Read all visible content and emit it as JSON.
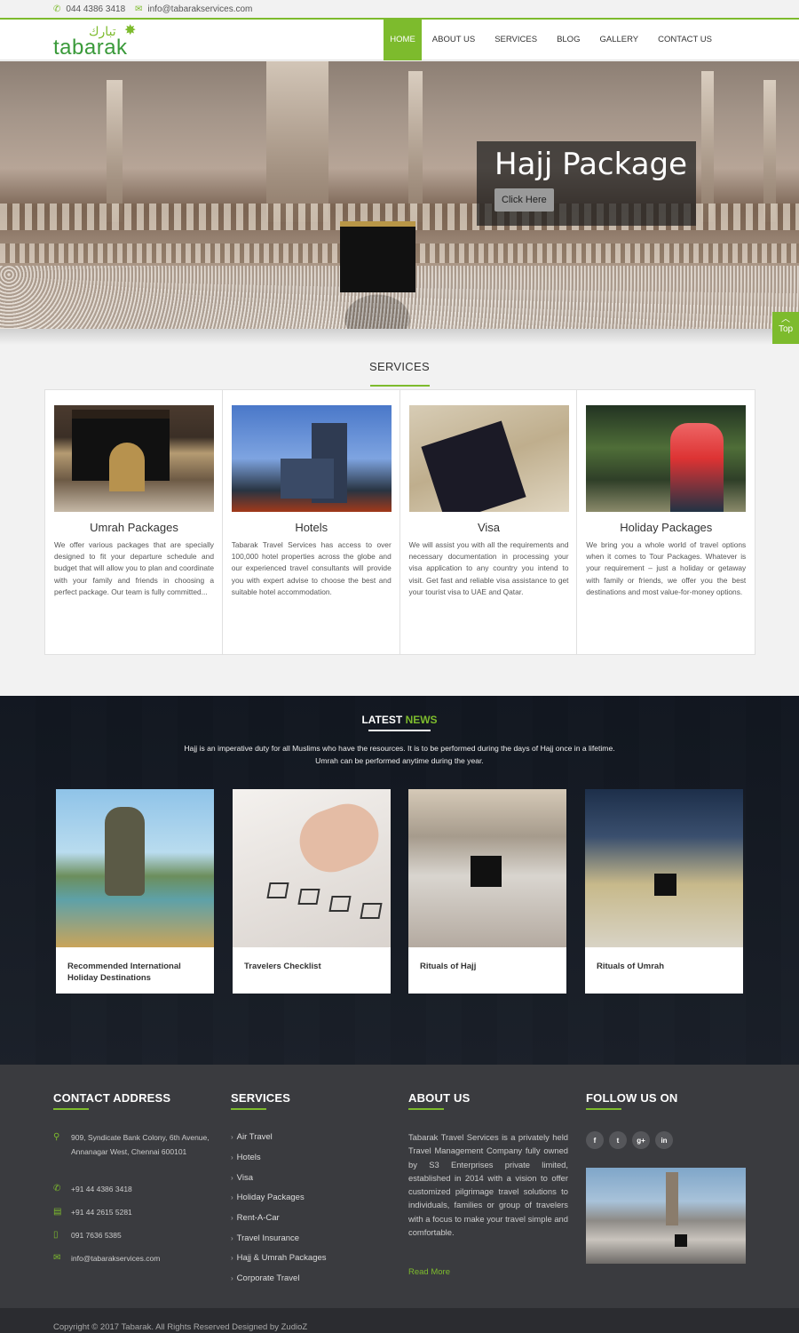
{
  "topbar": {
    "phone": "044 4386 3418",
    "email": "info@tabarakservices.com"
  },
  "brand": {
    "name": "tabarak",
    "arabic": "تبارك"
  },
  "nav": {
    "items": [
      "HOME",
      "ABOUT US",
      "SERVICES",
      "BLOG",
      "GALLERY",
      "CONTACT US"
    ],
    "active": "HOME"
  },
  "hero": {
    "title": "Hajj Package",
    "button": "Click Here"
  },
  "totop": {
    "label": "Top"
  },
  "services": {
    "title": "SERVICES",
    "cards": [
      {
        "title": "Umrah Packages",
        "text": "We offer various packages that are specially designed to fit your departure schedule and budget that will allow you to plan and coordinate with your family and friends in choosing a perfect package. Our team is fully committed..."
      },
      {
        "title": "Hotels",
        "text": "Tabarak Travel Services has access to over 100,000 hotel properties across the globe and our experienced travel consultants will provide you with expert advise to choose the best and suitable hotel accommodation."
      },
      {
        "title": "Visa",
        "text": "We will assist you with all the requirements and necessary documentation in processing your visa application to any country you intend to visit. Get fast and reliable visa assistance to get your tourist visa to UAE and Qatar."
      },
      {
        "title": "Holiday Packages",
        "text": "We bring you a whole world of travel options when it comes to Tour Packages. Whatever is your requirement – just a holiday or getaway with family or friends, we offer you the best destinations and most value-for-money options."
      }
    ]
  },
  "news": {
    "title_a": "LATEST",
    "title_b": "NEWS",
    "intro": "Hajj is an imperative duty for all Muslims who have the resources. It is to be performed during the days of Hajj once in a lifetime. Umrah can be performed anytime during the year.",
    "items": [
      "Recommended International Holiday Destinations",
      "Travelers Checklist",
      "Rituals of Hajj",
      "Rituals of Umrah"
    ]
  },
  "footer": {
    "contact": {
      "title": "CONTACT ADDRESS",
      "address": "909, Syndicate Bank Colony, 6th Avenue, Annanagar West, Chennai 600101",
      "phone1": "+91 44 4386 3418",
      "phone2": "+91 44 2615 5281",
      "mobile": "091 7636 5385",
      "email": "info@tabarakservices.com"
    },
    "services": {
      "title": "SERVICES",
      "items": [
        "Air Travel",
        "Hotels",
        "Visa",
        "Holiday Packages",
        "Rent-A-Car",
        "Travel Insurance",
        "Hajj & Umrah Packages",
        "Corporate Travel"
      ]
    },
    "about": {
      "title": "ABOUT US",
      "text": "Tabarak Travel Services is a privately held Travel Management Company fully owned by S3 Enterprises private limited, established in 2014 with a vision to offer customized pilgrimage travel solutions to individuals, families or group of travelers with a focus to make your travel simple and comfortable.",
      "read_more": "Read More"
    },
    "follow": {
      "title": "FOLLOW US ON",
      "icons": [
        "f",
        "t",
        "g+",
        "in"
      ]
    }
  },
  "copyright": "Copyright © 2017 Tabarak. All Rights Reserved Designed by ZudioZ"
}
